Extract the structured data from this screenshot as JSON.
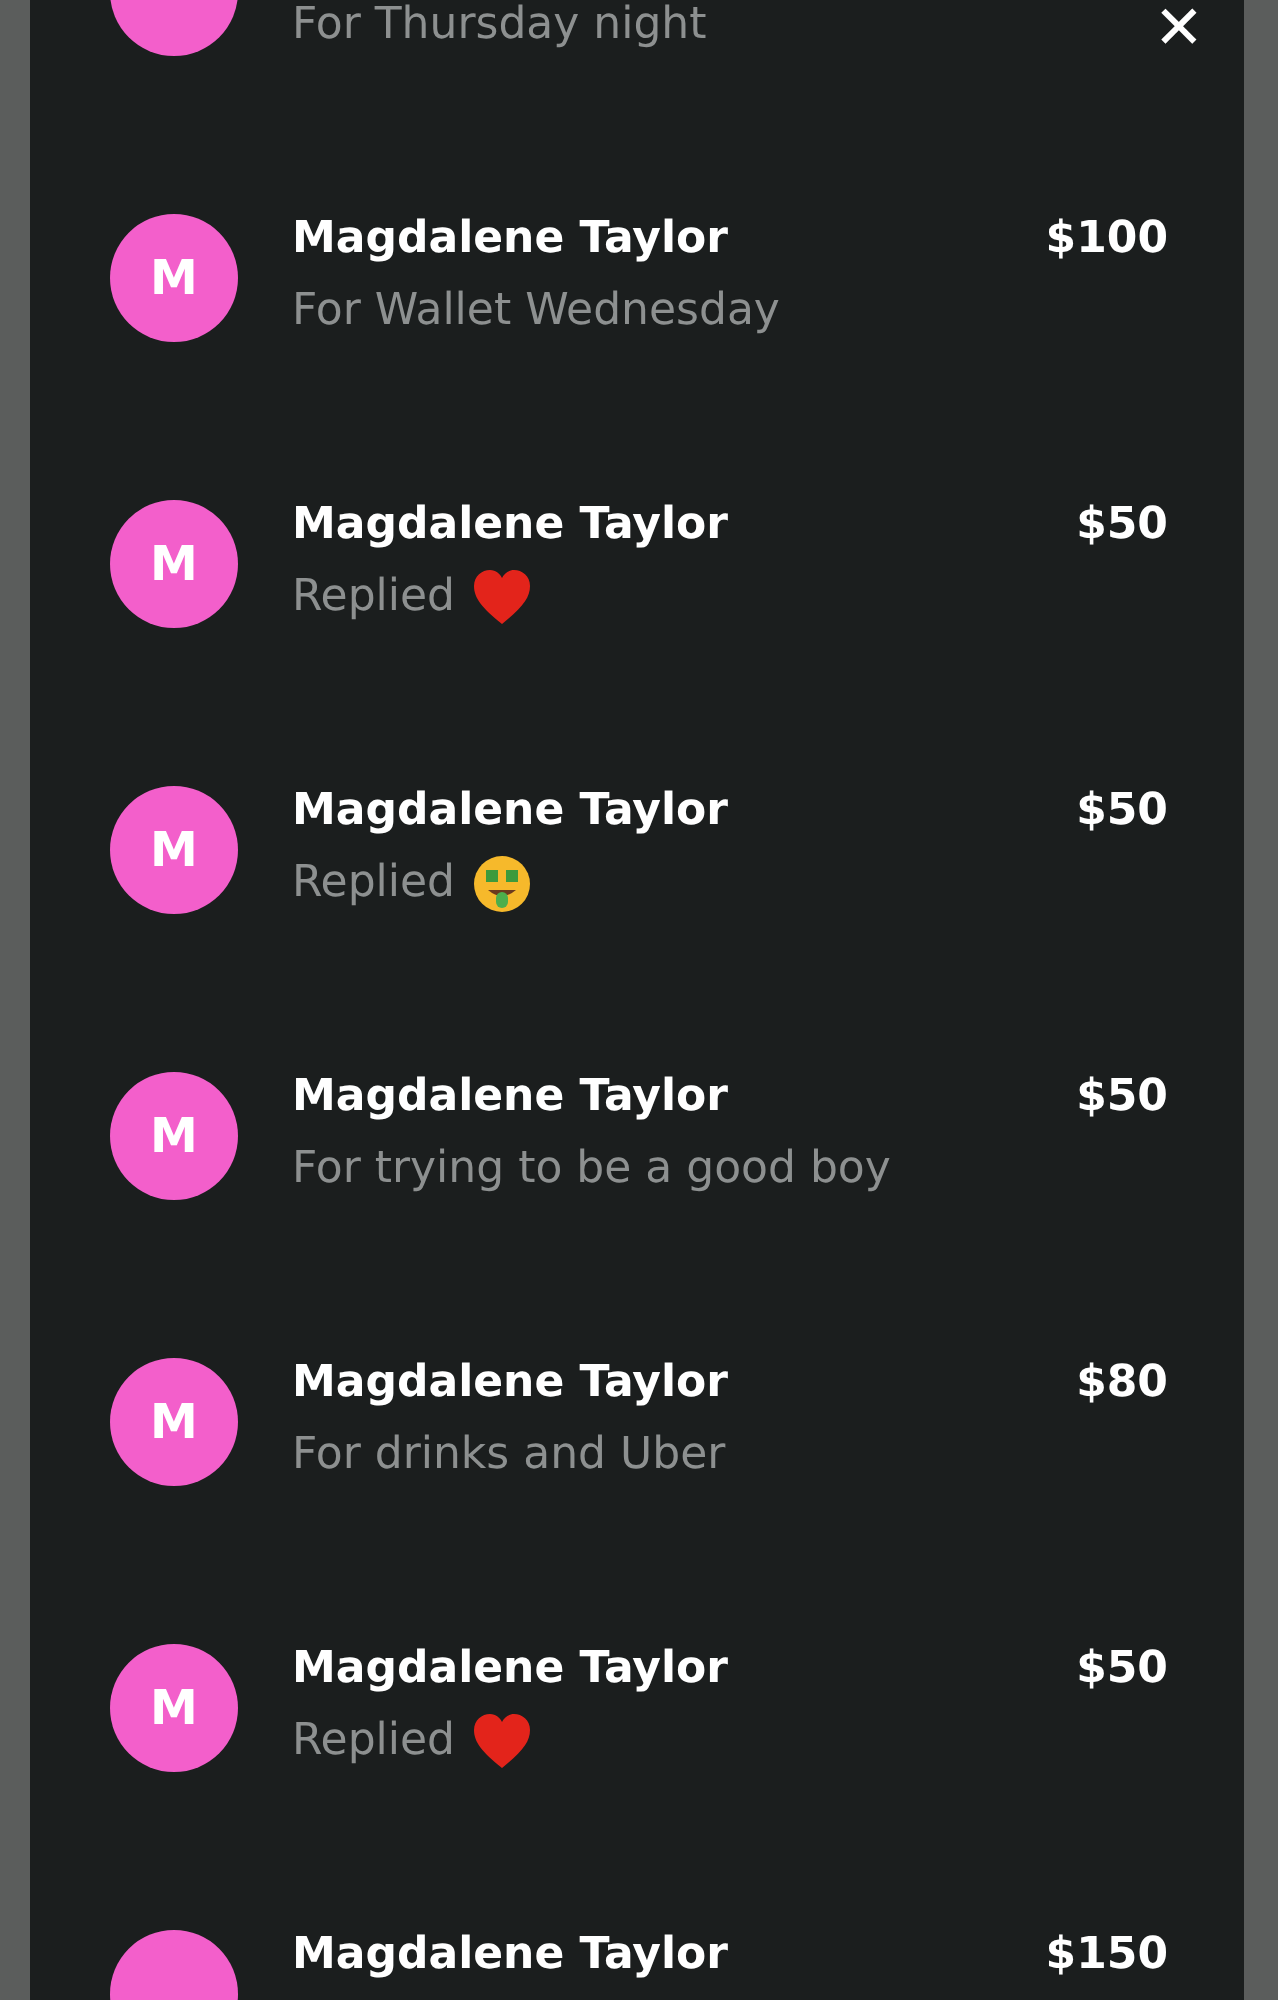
{
  "close_button": {
    "label": "✕"
  },
  "payments": [
    {
      "kind": "note",
      "subtitle": "For Thursday night"
    },
    {
      "kind": "note",
      "initial": "M",
      "name": "Magdalene Taylor",
      "amount": "$100",
      "subtitle": "For Wallet Wednesday"
    },
    {
      "kind": "heart",
      "initial": "M",
      "name": "Magdalene Taylor",
      "amount": "$50",
      "subtitle": "Replied"
    },
    {
      "kind": "money_face",
      "initial": "M",
      "name": "Magdalene Taylor",
      "amount": "$50",
      "subtitle": "Replied"
    },
    {
      "kind": "note",
      "initial": "M",
      "name": "Magdalene Taylor",
      "amount": "$50",
      "subtitle": "For trying to be a good boy"
    },
    {
      "kind": "note",
      "initial": "M",
      "name": "Magdalene Taylor",
      "amount": "$80",
      "subtitle": "For drinks and Uber"
    },
    {
      "kind": "heart",
      "initial": "M",
      "name": "Magdalene Taylor",
      "amount": "$50",
      "subtitle": "Replied"
    },
    {
      "name": "Magdalene Taylor",
      "amount": "$150"
    }
  ]
}
